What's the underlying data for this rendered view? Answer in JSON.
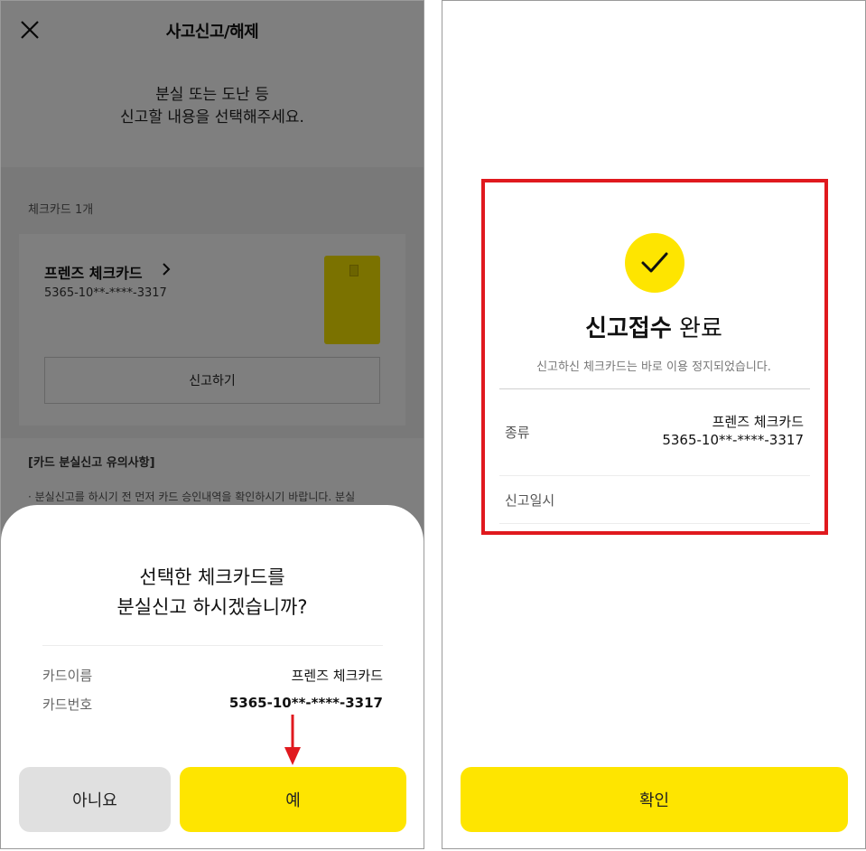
{
  "left": {
    "header": {
      "title": "사고신고/해제",
      "close_icon": "close-icon"
    },
    "intro": {
      "line1": "분실 또는 도난 등",
      "line2": "신고할 내용을 선택해주세요."
    },
    "card_count": "체크카드 1개",
    "card": {
      "name": "프렌즈 체크카드",
      "number": "5365-10**-****-3317",
      "report_button": "신고하기",
      "color": "#f7e500"
    },
    "notice": {
      "title": "[카드 분실신고 유의사항]",
      "body": "· 분실신고를 하시기 전 먼저 카드 승인내역을 확인하시기 바랍니다. 분실"
    },
    "sheet": {
      "message_line1": "선택한 체크카드를",
      "message_line2": "분실신고 하시겠습니까?",
      "rows": [
        {
          "label": "카드이름",
          "value": "프렌즈 체크카드"
        },
        {
          "label": "카드번호",
          "value": "5365-10**-****-3317"
        }
      ],
      "no_button": "아니요",
      "yes_button": "예"
    }
  },
  "right": {
    "result": {
      "title_bold": "신고접수",
      "title_rest": "완료",
      "subtitle": "신고하신 체크카드는 바로 이용 정지되었습니다.",
      "kind_label": "종류",
      "kind_value_line1": "프렌즈 체크카드",
      "kind_value_line2": "5365-10**-****-3317",
      "date_label": "신고일시"
    },
    "confirm_button": "확인"
  },
  "colors": {
    "accent_yellow": "#fee500",
    "highlight_red": "#e0191e",
    "arrow_red": "#e0191e"
  }
}
